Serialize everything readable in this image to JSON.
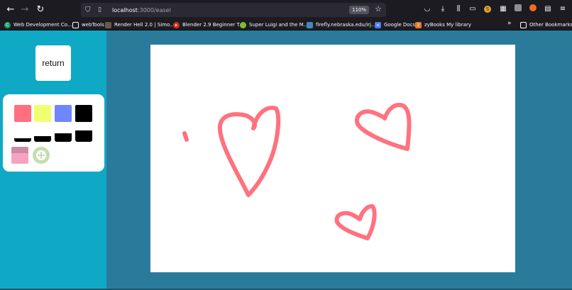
{
  "browser": {
    "url_host": "localhost",
    "url_path": ":3000/easel",
    "zoom": "110%",
    "bookmarks": [
      {
        "label": "Web Development Co...",
        "icon": "codecademy-icon",
        "color": "#1f9e6e"
      },
      {
        "label": "webTools",
        "icon": "folder-icon",
        "color": "#1c1b22"
      },
      {
        "label": "Render Hell 2.0 | Simo...",
        "icon": "site-icon",
        "color": "#6b5a4a"
      },
      {
        "label": "Blender 2.9 Beginner T...",
        "icon": "youtube-icon",
        "color": "#e02b20"
      },
      {
        "label": "Super Luigi and the M...",
        "icon": "site-icon",
        "color": "#7fbf2a"
      },
      {
        "label": "firefly.nebraska.edu/irj...",
        "icon": "site-icon",
        "color": "#3c8dbc"
      },
      {
        "label": "Google Docs",
        "icon": "docs-icon",
        "color": "#4a7cf0"
      },
      {
        "label": "zyBooks My library",
        "icon": "zybooks-icon",
        "color": "#e07a2a"
      }
    ],
    "other_bookmarks": "Other Bookmarks"
  },
  "app": {
    "return_label": "return",
    "colors": [
      "#ff6f7f",
      "#f0ff70",
      "#6f86ff",
      "#000000"
    ],
    "custom_color": "#f5a3c2",
    "canvas_stroke_color": "#ff6a78"
  }
}
